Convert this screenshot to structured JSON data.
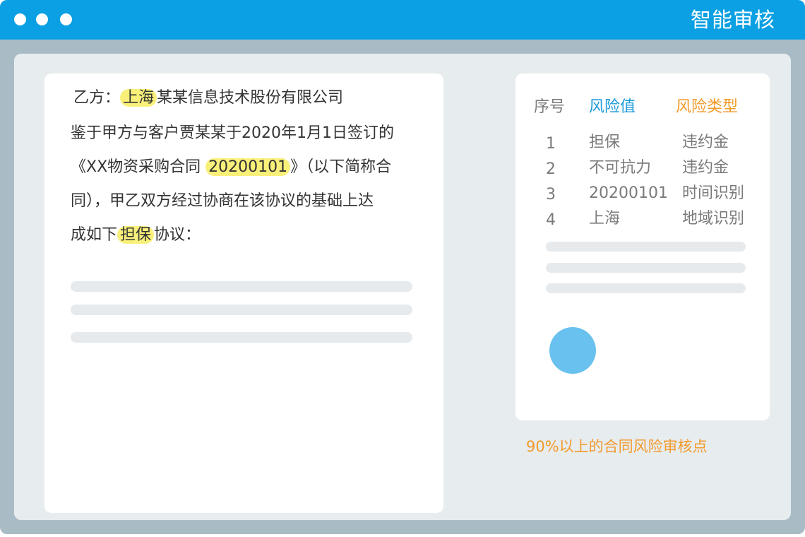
{
  "app": {
    "title": "智能审核",
    "accent_color": "#0aa0e3"
  },
  "document": {
    "party_prefix": "乙方：",
    "party_highlight": "上海",
    "party_rest": "某某信息技术股份有限公司",
    "line2": "鉴于甲方与客户贾某某于2020年1月1日签订的",
    "line3_before": "《XX物资采购合同 ",
    "line3_highlight": "20200101",
    "line3_after": "》（以下简称合",
    "line4": "同），甲乙双方经过协商在该协议的基础上达",
    "line5_before": "成如下",
    "line5_highlight": "担保",
    "line5_after": "协议：",
    "highlight_color": "#f9f07a"
  },
  "risk_table": {
    "headers": {
      "index": "序号",
      "risk_value": "风险值",
      "risk_type": "风险类型"
    },
    "header_colors": {
      "index": "#7a7a7a",
      "risk_value": "#1a9ad9",
      "risk_type": "#f29a2b"
    },
    "rows": [
      {
        "index": "1",
        "risk_value": "担保",
        "risk_type": "违约金"
      },
      {
        "index": "2",
        "risk_value": "不可抗力",
        "risk_type": "违约金"
      },
      {
        "index": "3",
        "risk_value": "20200101",
        "risk_type": "时间识别"
      },
      {
        "index": "4",
        "risk_value": "上海",
        "risk_type": "地域识别"
      }
    ]
  },
  "caption": "90%以上的合同风险审核点"
}
